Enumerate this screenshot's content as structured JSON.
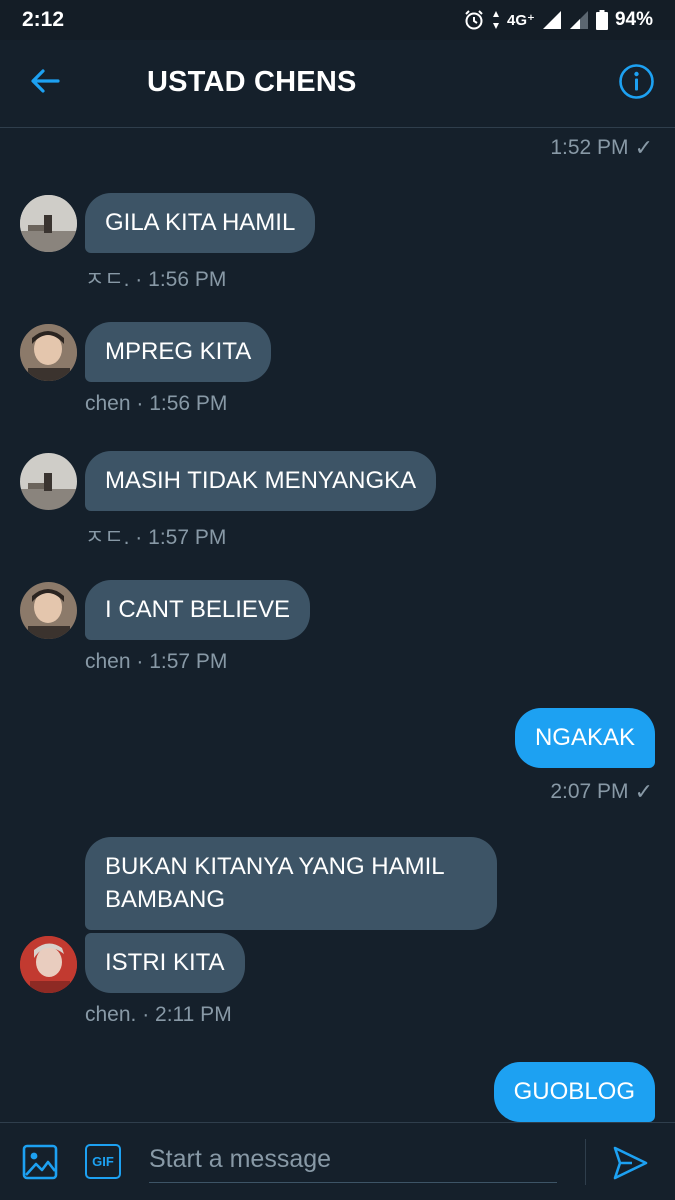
{
  "status_bar": {
    "time": "2:12",
    "network": "4G⁺",
    "battery": "94%"
  },
  "header": {
    "title": "USTAD CHENS",
    "back_icon": "arrow-left-icon",
    "info_icon": "info-circle-icon"
  },
  "messages": [
    {
      "meta": "1:52 PM"
    },
    {
      "text": "GILA KITA HAMIL",
      "meta": "ㅈㄷ. · 1:56 PM"
    },
    {
      "text": "MPREG KITA",
      "meta": "chen · 1:56 PM"
    },
    {
      "text": "MASIH TIDAK MENYANGKA",
      "meta": "ㅈㄷ. · 1:57 PM"
    },
    {
      "text": "I CANT BELIEVE",
      "meta": "chen · 1:57 PM"
    },
    {
      "text": "NGAKAK",
      "meta": "2:07 PM"
    },
    {
      "text": "BUKAN KITANYA YANG HAMIL BAMBANG"
    },
    {
      "text": "ISTRI KITA",
      "meta": "chen. · 2:11 PM"
    },
    {
      "text": "GUOBLOG"
    }
  ],
  "read_check": "✓",
  "composer": {
    "placeholder": "Start a message",
    "gif_label": "GIF"
  },
  "colors": {
    "background": "#15202b",
    "incoming_bubble": "#3d5466",
    "outgoing_bubble": "#1da1f2",
    "accent": "#1da1f2",
    "meta_text": "#8899a6"
  }
}
